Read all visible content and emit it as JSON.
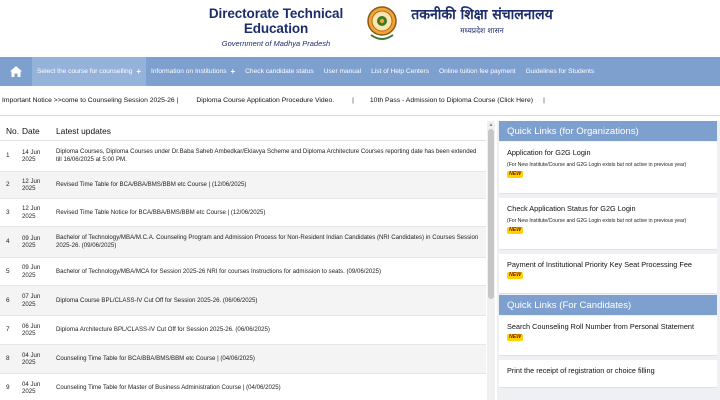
{
  "header": {
    "title_en": "Directorate Technical Education",
    "subtitle_en": "Government of Madhya Pradesh",
    "title_hi": "तकनीकी शिक्षा संचालनालय",
    "subtitle_hi": "मध्यप्रदेश शासन"
  },
  "nav": {
    "items": [
      {
        "label": "Select the course for counselling",
        "has_plus": true
      },
      {
        "label": "Information on Institutions",
        "has_plus": true
      },
      {
        "label": "Check candidate status"
      },
      {
        "label": "User manual"
      },
      {
        "label": "List of Help Centers"
      },
      {
        "label": "Online tuition fee payment"
      },
      {
        "label": "Guidelines for Students"
      }
    ],
    "plus": "+"
  },
  "notice": {
    "label": "Important Notice >>",
    "messages": [
      "come to Counseling Session 2025-26 |",
      "Diploma Course Application Procedure Video.",
      "10th Pass - Admission to Diploma Course (Click Here)"
    ],
    "separator": "|"
  },
  "updates": {
    "headers": {
      "no": "No.",
      "date": "Date",
      "text": "Latest updates"
    },
    "rows": [
      {
        "no": "1",
        "date": "14 Jun 2025",
        "text": "Diploma Courses, Diploma Courses under Dr.Baba Saheb Ambedkar/Eklavya Scheme and Diploma Architecture Courses reporting date has been extended till 16/06/2025 at 5:00 PM."
      },
      {
        "no": "2",
        "date": "12 Jun 2025",
        "text": "Revised Time Table for BCA/BBA/BMS/BBM etc Course | (12/06/2025)"
      },
      {
        "no": "3",
        "date": "12 Jun 2025",
        "text": "Revised Time Table Notice for BCA/BBA/BMS/BBM etc Course | (12/06/2025)"
      },
      {
        "no": "4",
        "date": "09 Jun 2025",
        "text": "Bachelor of Technology/MBA/M.C.A. Counseling Program and Admission Process for Non-Resident Indian Candidates (NRI Candidates) in Courses Session 2025-26. (09/06/2025)"
      },
      {
        "no": "5",
        "date": "09 Jun 2025",
        "text": "Bachelor of Technology/MBA/MCA for Session 2025-26 NRI for courses Instructions for admission to seats. (09/06/2025)"
      },
      {
        "no": "6",
        "date": "07 Jun 2025",
        "text": "Diploma Course BPL/CLASS-IV Cut Off for Session 2025-26. (06/06/2025)"
      },
      {
        "no": "7",
        "date": "06 Jun 2025",
        "text": "Diploma Architecture BPL/CLASS-IV Cut Off for Session 2025-26. (06/06/2025)"
      },
      {
        "no": "8",
        "date": "04 Jun 2025",
        "text": "Counseling Time Table for BCA/BBA/BMS/BBM etc Course | (04/06/2025)"
      },
      {
        "no": "9",
        "date": "04 Jun 2025",
        "text": "Counseling Time Table for Master of Business Administration Course | (04/06/2025)"
      }
    ]
  },
  "quick_links_org": {
    "title": "Quick Links (for Organizations)",
    "items": [
      {
        "title": "Application for G2G Login",
        "note": "(For New Institute/Course and G2G Login exists but not active in previous year)",
        "badge": "NEW"
      },
      {
        "title": "Check Application Status for G2G Login",
        "note": "(For New Institute/Course and G2G Login exists but not active in previous year)",
        "badge": "NEW"
      },
      {
        "title": "Payment of Institutional Priority Key Seat Processing Fee",
        "badge": "NEW"
      }
    ]
  },
  "quick_links_cand": {
    "title": "Quick Links (For Candidates)",
    "items": [
      {
        "title": "Search Counseling Roll Number from Personal Statement",
        "badge": "NEW"
      },
      {
        "title": "Print the receipt of registration or choice filling"
      }
    ]
  },
  "colors": {
    "nav_bg": "#7ea0cf",
    "title_blue": "#1d2c6b",
    "badge_bg": "#ffd200"
  }
}
